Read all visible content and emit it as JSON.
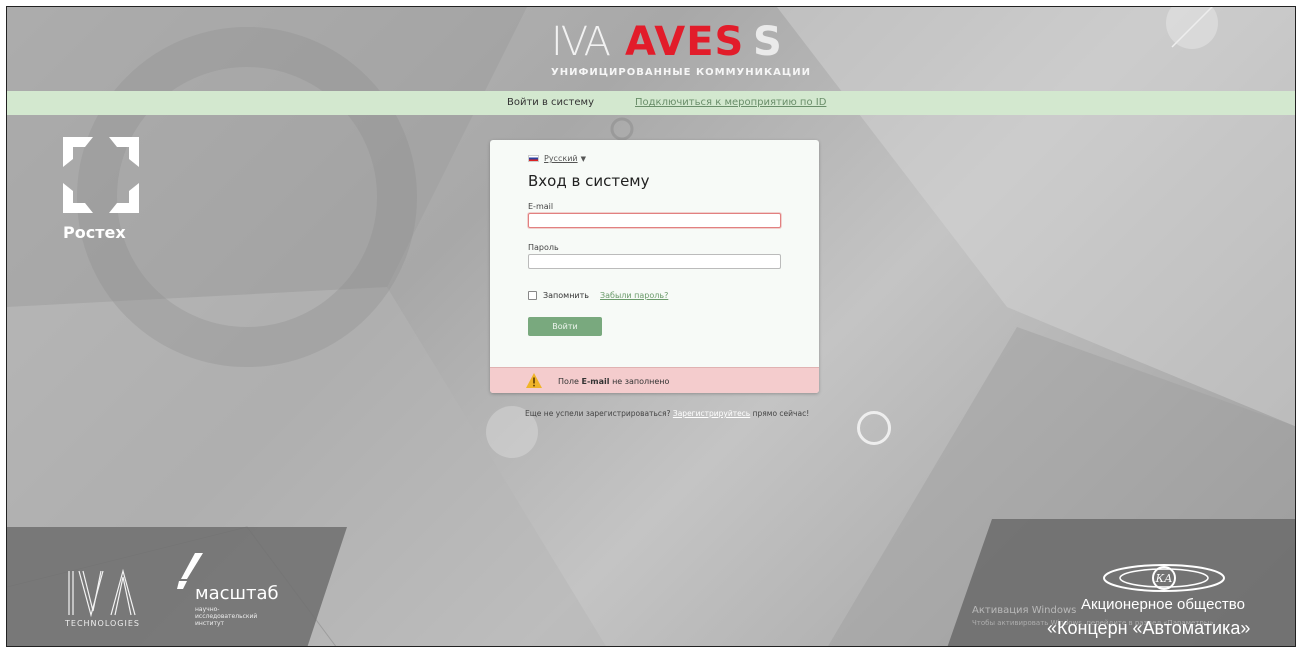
{
  "header": {
    "brand_left": "IVA",
    "brand_main": "AVES",
    "brand_tail": "S",
    "subtitle": "УНИФИЦИРОВАННЫЕ КОММУНИКАЦИИ"
  },
  "nav": {
    "login": "Войти в систему",
    "join_event": "Подключиться к мероприятию по ID"
  },
  "left_brand": {
    "name": "Ростех"
  },
  "login_form": {
    "language": "Русский",
    "title": "Вход в систему",
    "email_label": "E-mail",
    "email_value": "",
    "password_label": "Пароль",
    "password_value": "",
    "remember_label": "Запомнить",
    "forgot_link": "Забыли пароль?",
    "submit_label": "Войти",
    "error_prefix": "Поле",
    "error_field": "E-mail",
    "error_suffix": "не заполнено"
  },
  "register": {
    "prefix": "Еще не успели зарегистрироваться?",
    "link": "Зарегистрируйтесь",
    "suffix": "прямо сейчас!"
  },
  "footer_left": {
    "iva_tech": "TECHNOLOGIES",
    "masshtab_name": "масштаб",
    "masshtab_desc_1": "научно-",
    "masshtab_desc_2": "исследовательский",
    "masshtab_desc_3": "институт"
  },
  "footer_right": {
    "ka_monogram": "КА",
    "line1": "Акционерное общество",
    "line2": "«Концерн «Автоматика»",
    "windows_activation": "Активация Windows",
    "windows_activation_hint": "Чтобы активировать Windows, перейдите в раздел «Параметры»."
  },
  "colors": {
    "nav_bg": "#d3e8cf",
    "brand_red": "#e21c2a",
    "button_green": "#79a97e",
    "error_bg": "#f4cccd"
  },
  "icons": {
    "warning": "warning-icon",
    "flag": "russia-flag-icon"
  }
}
